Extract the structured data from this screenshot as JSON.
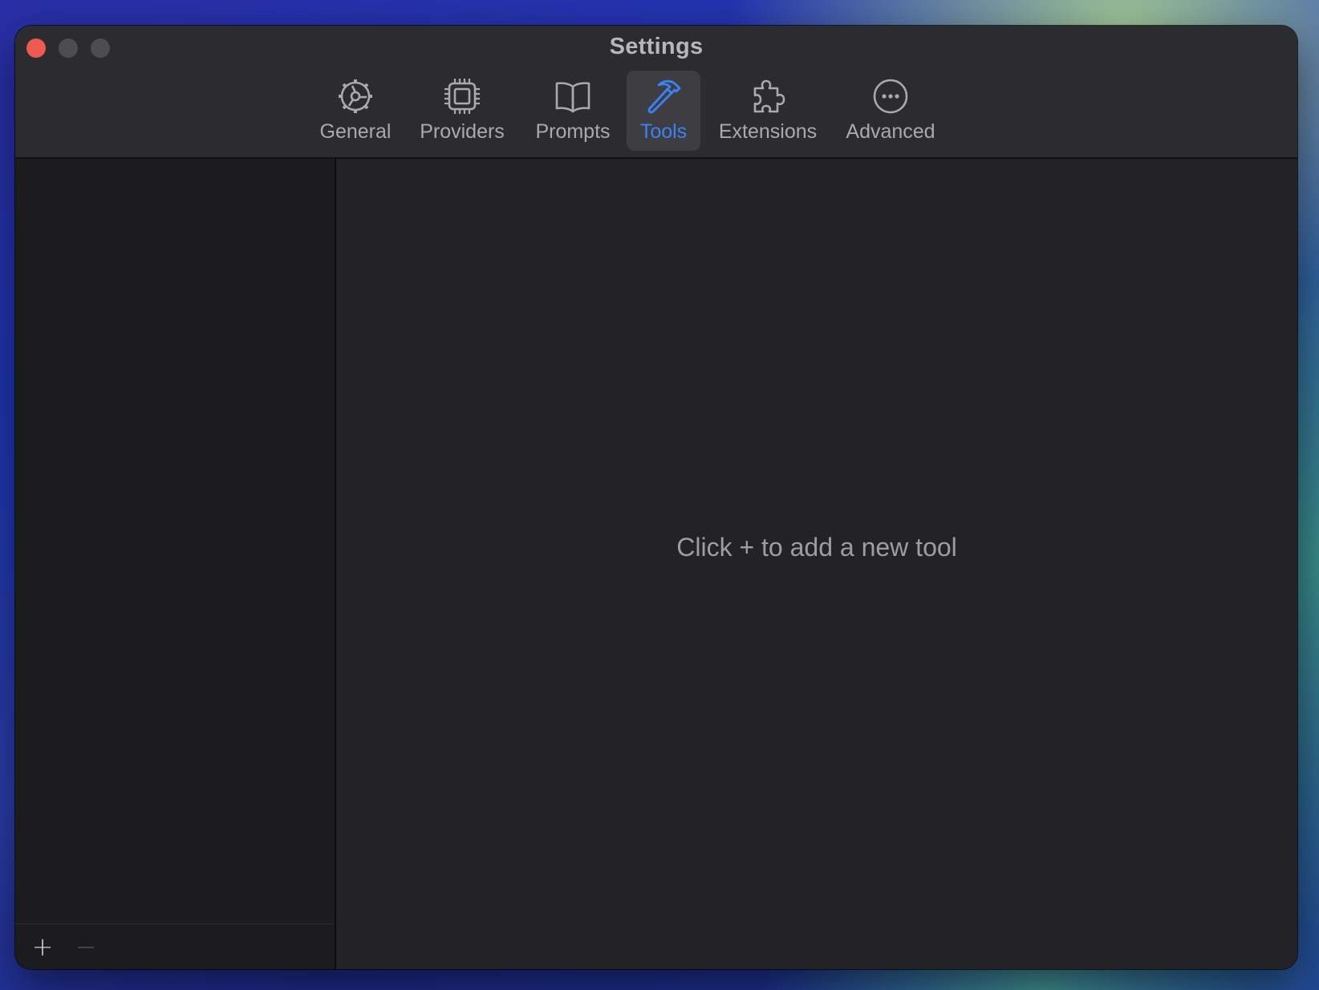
{
  "window": {
    "title": "Settings"
  },
  "tabs": [
    {
      "label": "General",
      "icon": "gear-icon",
      "active": false
    },
    {
      "label": "Providers",
      "icon": "chip-icon",
      "active": false
    },
    {
      "label": "Prompts",
      "icon": "book-icon",
      "active": false
    },
    {
      "label": "Tools",
      "icon": "hammer-icon",
      "active": true
    },
    {
      "label": "Extensions",
      "icon": "puzzle-icon",
      "active": false
    },
    {
      "label": "Advanced",
      "icon": "ellipsis-circle-icon",
      "active": false
    }
  ],
  "sidebar": {
    "add_label": "+",
    "remove_label": "−"
  },
  "main": {
    "empty_message": "Click + to add a new tool"
  },
  "colors": {
    "accent": "#3b82f6",
    "close": "#ef5a50"
  }
}
